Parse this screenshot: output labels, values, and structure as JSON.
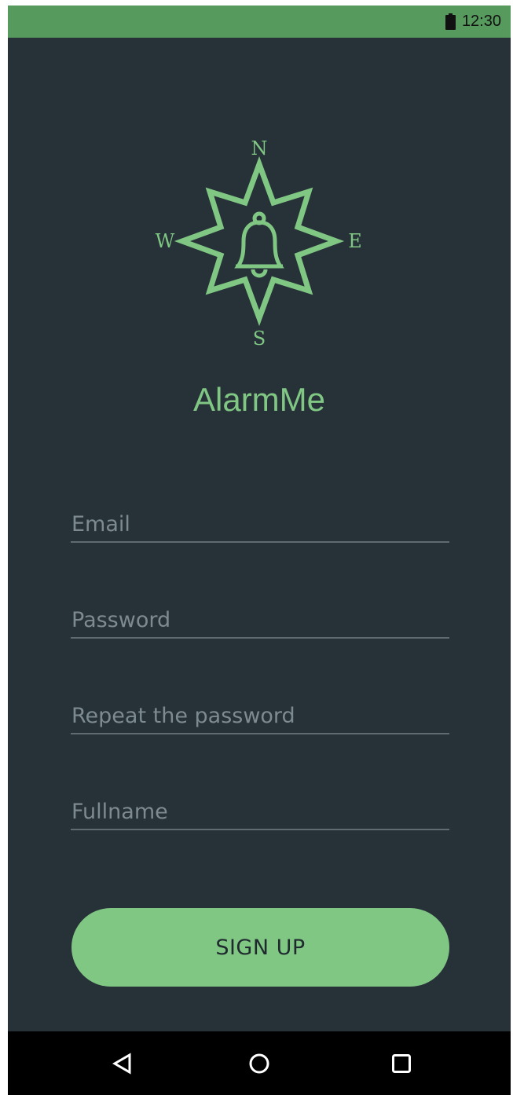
{
  "status_bar": {
    "time": "12:30",
    "battery_icon": "battery-full-icon",
    "background": "#579a5d"
  },
  "logo": {
    "icon": "compass-bell-icon",
    "n": "N",
    "e": "E",
    "s": "S",
    "w": "W",
    "color": "#81c784"
  },
  "app": {
    "title": "AlarmMe",
    "background": "#263238",
    "accent": "#81c784"
  },
  "form": {
    "email": {
      "placeholder": "Email",
      "value": ""
    },
    "password": {
      "placeholder": "Password",
      "value": ""
    },
    "repeat_password": {
      "placeholder": "Repeat the password",
      "value": ""
    },
    "fullname": {
      "placeholder": "Fullname",
      "value": ""
    },
    "submit_label": "SIGN UP"
  },
  "nav_bar": {
    "back_icon": "back-triangle-icon",
    "home_icon": "home-circle-icon",
    "recents_icon": "recents-square-icon"
  }
}
